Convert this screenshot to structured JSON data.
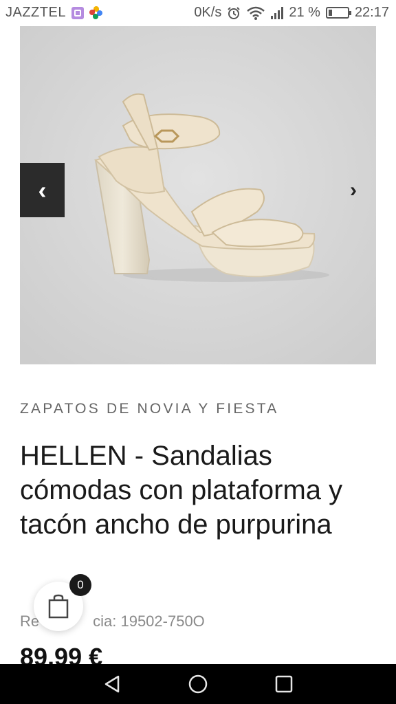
{
  "status_bar": {
    "carrier": "JAZZTEL",
    "network_speed": "0K/s",
    "battery_percent": "21 %",
    "battery_level": 0.21,
    "time": "22:17",
    "icons": [
      "app-badge-icon",
      "photos-icon",
      "alarm-icon",
      "wifi-icon",
      "signal-icon",
      "battery-icon"
    ]
  },
  "gallery": {
    "prev_label": "‹",
    "next_label": "›"
  },
  "product": {
    "category": "ZAPATOS DE NOVIA Y FIESTA",
    "title": "HELLEN - Sandalias cómodas con plataforma y tacón ancho de purpurina",
    "reference_prefix": "Re",
    "reference_hidden": "ferencia: ",
    "reference_value": "cia: 19502-750O",
    "price": "89,99 €"
  },
  "cart": {
    "count": "0"
  },
  "navigation": {
    "items": [
      "back-icon",
      "home-icon",
      "recents-icon"
    ]
  },
  "colors": {
    "image_bg": "#d4d4d4",
    "shoe": "#eadfce",
    "dark": "#2b2b2b"
  }
}
